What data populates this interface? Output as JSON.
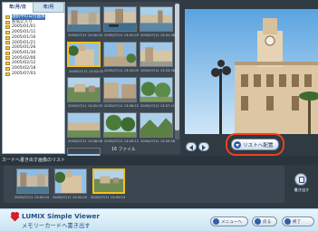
{
  "tree": {
    "tabs": [
      {
        "label": "年/月/日"
      },
      {
        "label": "年/月"
      }
    ],
    "items": [
      {
        "label": "選択中の日付画像"
      },
      {
        "label": "お気に入り"
      },
      {
        "label": "2005/01/01"
      },
      {
        "label": "2005/01/11"
      },
      {
        "label": "2005/01/16"
      },
      {
        "label": "2005/01/21"
      },
      {
        "label": "2005/01/26"
      },
      {
        "label": "2005/01/30"
      },
      {
        "label": "2005/02/06"
      },
      {
        "label": "2005/02/12"
      },
      {
        "label": "2005/02/18"
      },
      {
        "label": "2005/07/03"
      }
    ]
  },
  "thumbs": {
    "dates": [
      "2005/07/11 13:00:04",
      "2005/07/11 13:01:03",
      "2005/07/11 13:01:38",
      "2005/07/11 13:02:05",
      "2005/07/11 13:03:05",
      "2005/07/11 13:03:38",
      "2005/07/11 13:05:03",
      "2005/07/11 13:06:22",
      "2005/07/11 13:07:11",
      "2005/07/11 13:08:08",
      "2005/07/11 13:09:12",
      "2005/07/11 13:09:36",
      "2005/07/11 13:10:03"
    ],
    "file_count": "16 ファイル"
  },
  "list_button": {
    "label": "リストへ配置"
  },
  "list": {
    "title": "カードへ書き出す画像のリスト",
    "dates": [
      "2005/07/11 13:00:04",
      "2005/07/11 13:02:05",
      "2005/07/11 13:05:03"
    ]
  },
  "write": {
    "label": "書き出す"
  },
  "footer": {
    "app_name": "LUMIX Simple Viewer",
    "subtitle": "メモリーカードへ書き出す",
    "buttons": [
      {
        "label": "メニューへ"
      },
      {
        "label": "戻る"
      },
      {
        "label": "終了"
      }
    ]
  },
  "colors": {
    "highlight_ring": "#f2401d",
    "selection": "#f6c21a",
    "accent_blue": "#345fa5"
  },
  "icons": {
    "prev": "arrow-left-icon",
    "next": "arrow-right-icon",
    "list": "download-icon",
    "write": "card-icon",
    "logo": "lumix-heart-logo"
  }
}
